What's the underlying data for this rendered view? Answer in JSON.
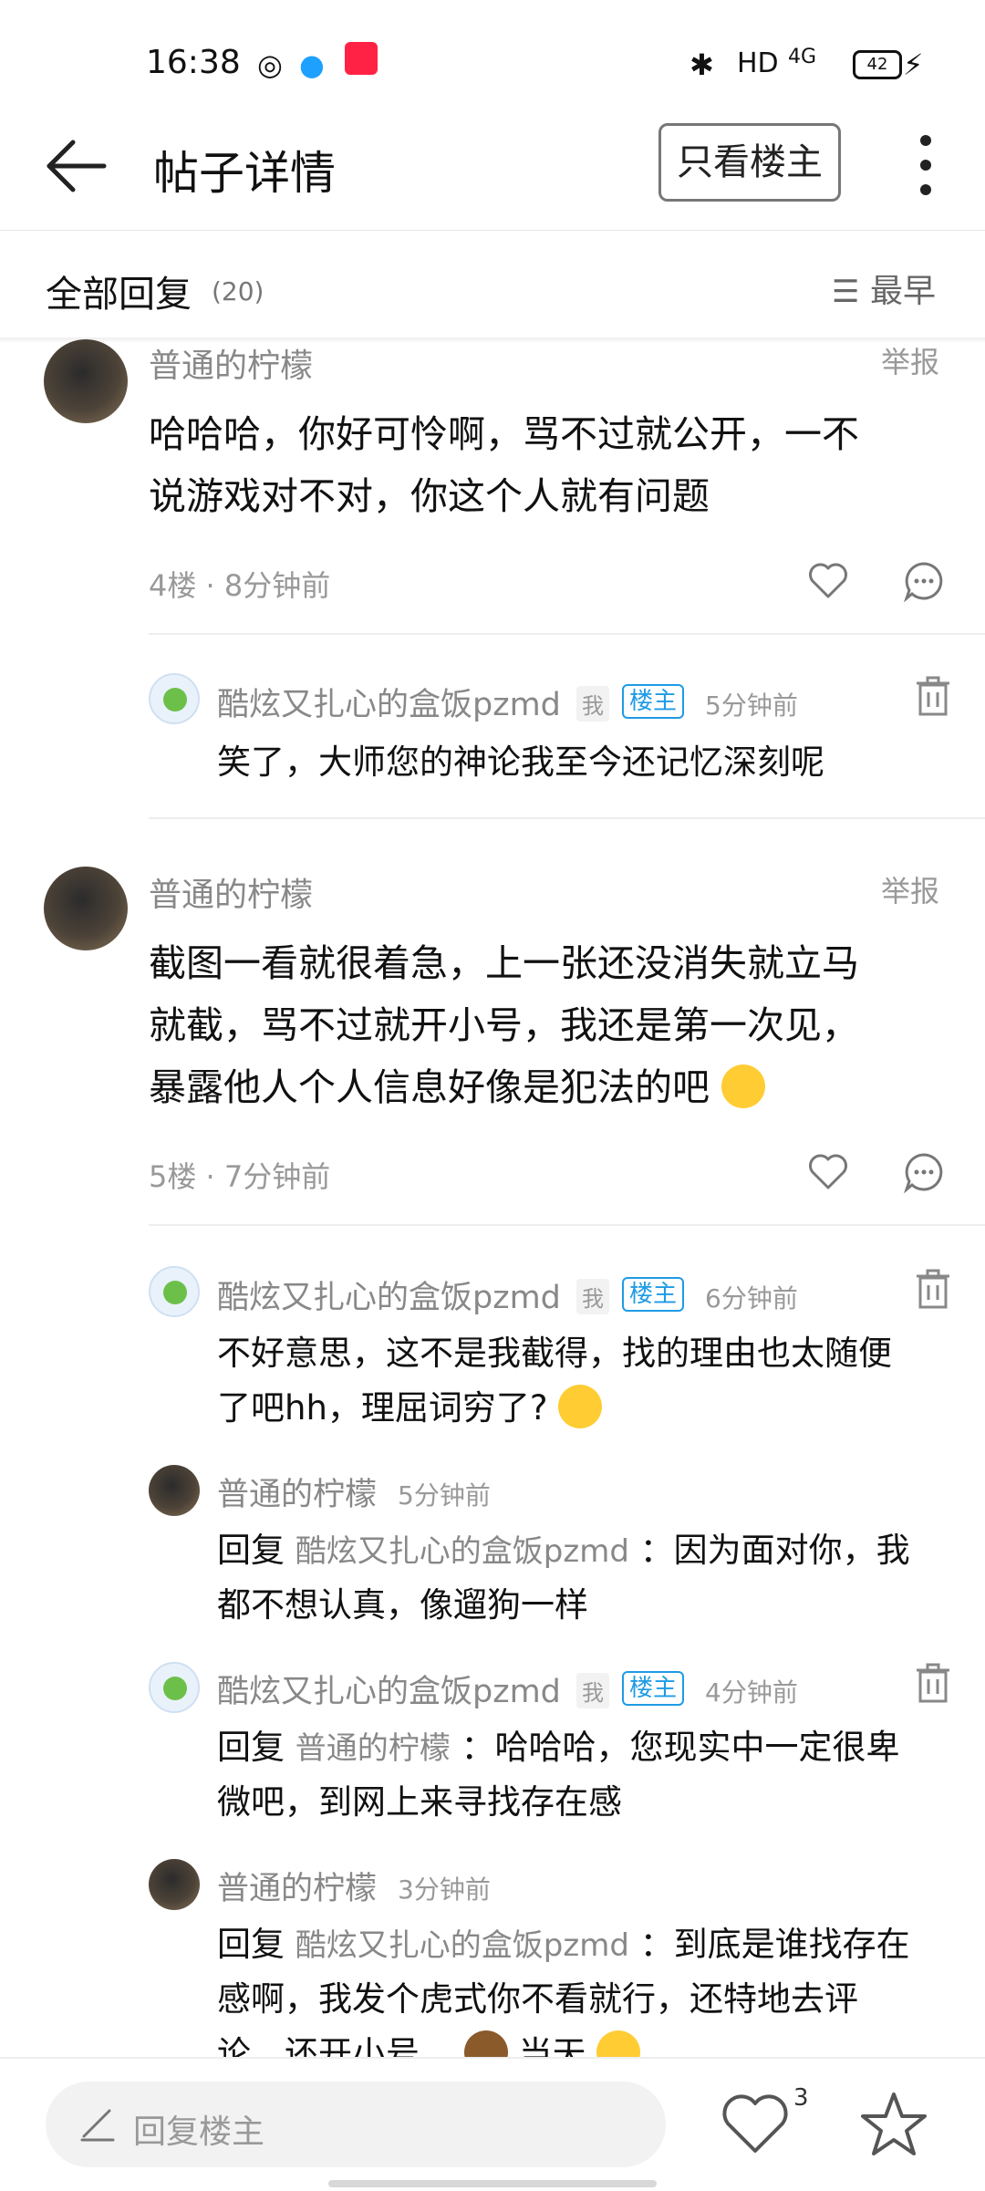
{
  "status_bar": {
    "time": "16:38",
    "network": "HD",
    "signal": "4G",
    "battery": "42"
  },
  "header": {
    "title": "帖子详情",
    "owner_only_label": "只看楼主"
  },
  "replies": {
    "title": "全部回复",
    "count": "(20)",
    "sort_label": "最早"
  },
  "posts": [
    {
      "username": "普通的柠檬",
      "report": "举报",
      "content_line1": "哈哈哈，你好可怜啊，骂不过就公开，一不",
      "content_line2": "说游戏对不对，你这个人就有问题",
      "meta": "4楼 · 8分钟前",
      "subreplies": [
        {
          "username": "酷炫又扎心的盒饭pzmd",
          "me": "我",
          "lz": "楼主",
          "time": "5分钟前",
          "text": "笑了，大师您的神论我至今还记忆深刻呢"
        }
      ]
    },
    {
      "username": "普通的柠檬",
      "report": "举报",
      "content_line1": "截图一看就很着急，上一张还没消失就立马",
      "content_line2": "就截，骂不过就开小号，我还是第一次见，",
      "content_line3": "暴露他人个人信息好像是犯法的吧",
      "meta": "5楼 · 7分钟前",
      "subreplies": [
        {
          "username": "酷炫又扎心的盒饭pzmd",
          "me": "我",
          "lz": "楼主",
          "time": "6分钟前",
          "line1": "不好意思，这不是我截得，找的理由也太随便",
          "line2": "了吧hh，理屈词穷了?"
        },
        {
          "username": "普通的柠檬",
          "time": "5分钟前",
          "reply_prefix": "回复",
          "reply_to": "酷炫又扎心的盒饭pzmd",
          "line1": "：因为面对你，我",
          "line2": "都不想认真，像遛狗一样"
        },
        {
          "username": "酷炫又扎心的盒饭pzmd",
          "me": "我",
          "lz": "楼主",
          "time": "4分钟前",
          "reply_prefix": "回复",
          "reply_to": "普通的柠檬",
          "line1": "：哈哈哈，您现实中一定很卑",
          "line2": "微吧，到网上来寻找存在感"
        },
        {
          "username": "普通的柠檬",
          "time": "3分钟前",
          "reply_prefix": "回复",
          "reply_to": "酷炫又扎心的盒饭pzmd",
          "line1": "：到底是谁找存在",
          "line2": "感啊，我发个虎式你不看就行，还特地去评",
          "line3": "论，还开小号，",
          "line3_end": "当天"
        }
      ]
    }
  ],
  "bottom_bar": {
    "reply_placeholder": "回复楼主",
    "like_count": "3"
  },
  "colors": {
    "accent_blue": "#1e9be5",
    "gray_text": "#999999",
    "divider": "#eeeeee"
  },
  "icons": [
    "back-arrow-icon",
    "more-vertical-icon",
    "sort-icon",
    "heart-icon",
    "comment-icon",
    "trash-icon",
    "pencil-icon",
    "star-icon"
  ]
}
